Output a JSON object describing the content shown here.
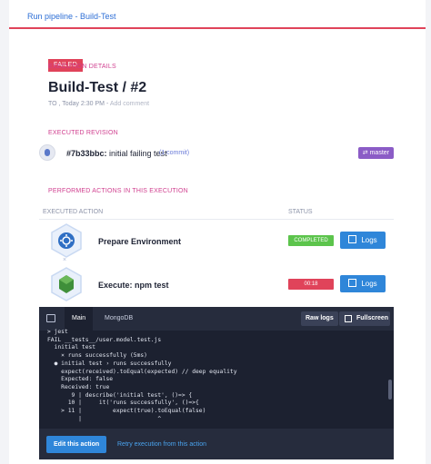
{
  "breadcrumb": "Run pipeline - Build-Test",
  "status_badge": "FAILED",
  "details": {
    "section_title": "EXECUTION DETAILS",
    "title": "Build-Test / #2",
    "meta_user": "TO , Today 2:30 PM - ",
    "add_comment": "Add comment"
  },
  "revision": {
    "section_title": "EXECUTED REVISION",
    "commit_hash": "#7b33bbc:",
    "commit_message": " initial failing test",
    "commit_count": "(1 commit)",
    "branch": "master"
  },
  "actions": {
    "section_title": "PERFORMED ACTIONS IN THIS EXECUTION",
    "col_action": "EXECUTED ACTION",
    "col_status": "STATUS",
    "logs_label": "Logs",
    "items": [
      {
        "name": "Prepare Environment",
        "status": "COMPLETED",
        "status_color": "#5cc44c"
      },
      {
        "name": "Execute: npm test",
        "status": "00:18",
        "status_color": "#e0435a"
      }
    ]
  },
  "console": {
    "tabs": [
      "Main",
      "MongoDB"
    ],
    "raw_logs": "Raw logs",
    "fullscreen": "Fullscreen",
    "log": "> jest\nFAIL __tests__/user.model.test.js\n  initial test\n    × runs successfully (5ms)\n  ● initial test › runs successfully\n    expect(received).toEqual(expected) // deep equality\n    Expected: false\n    Received: true\n       9 | describe('initial test', ()=> {\n      10 |     it('runs successfully', ()=>{\n    > 11 |         expect(true).toEqual(false)\n         |                      ^",
    "edit_action": "Edit this action",
    "retry": "Retry execution from this action"
  },
  "colors": {
    "accent": "#d03f8f",
    "primary": "#2f86d9",
    "danger": "#e0435a",
    "success": "#5cc44c",
    "branch": "#8b5cc6"
  }
}
